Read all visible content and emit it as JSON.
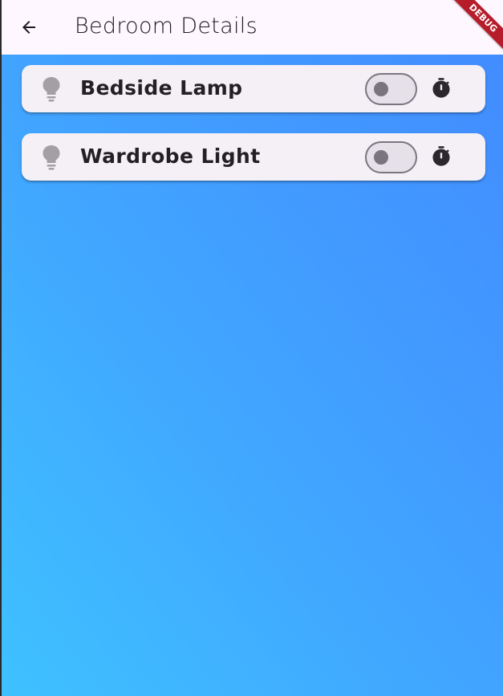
{
  "app_bar": {
    "title": "Bedroom Details",
    "back_icon": "arrow-back-icon"
  },
  "devices": [
    {
      "label": "Bedside Lamp",
      "icon": "lightbulb-icon",
      "switch_on": false,
      "timer_icon": "timer-icon"
    },
    {
      "label": "Wardrobe Light",
      "icon": "lightbulb-icon",
      "switch_on": false,
      "timer_icon": "timer-icon"
    }
  ],
  "debug_banner": {
    "label": "DEBUG"
  },
  "colors": {
    "app_bar_bg": "#fef7ff",
    "gradient_top_right": "#428cff",
    "gradient_bottom_left": "#3ec1ff",
    "card_bg": "#f4f0f6",
    "debug_ribbon": "#b71c2b"
  }
}
